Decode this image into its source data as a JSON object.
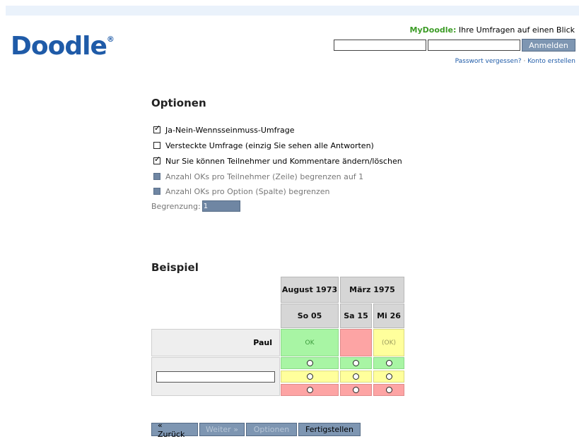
{
  "header": {
    "logo_text": "Doodle",
    "logo_mark": "®",
    "mydoodle_brand": "MyDoodle:",
    "mydoodle_tagline": "Ihre Umfragen auf einen Blick",
    "username_value": "",
    "password_value": "",
    "login_button": "Anmelden",
    "forgot_password": "Passwort vergessen?",
    "separator": "·",
    "create_account": "Konto erstellen"
  },
  "options": {
    "title": "Optionen",
    "items": [
      {
        "label": "Ja-Nein-Wennsseinmuss-Umfrage",
        "checked": true,
        "disabled": false
      },
      {
        "label": "Versteckte Umfrage (einzig Sie sehen alle Antworten)",
        "checked": false,
        "disabled": false
      },
      {
        "label": "Nur Sie können Teilnehmer und Kommentare ändern/löschen",
        "checked": true,
        "disabled": false
      },
      {
        "label": "Anzahl OKs pro Teilnehmer (Zeile) begrenzen auf 1",
        "checked": false,
        "disabled": true
      },
      {
        "label": "Anzahl OKs pro Option (Spalte) begrenzen",
        "checked": false,
        "disabled": true
      }
    ],
    "limit_label": "Begrenzung:",
    "limit_value": "1"
  },
  "example": {
    "title": "Beispiel",
    "months": [
      "August 1973",
      "März 1975"
    ],
    "days": [
      "So 05",
      "Sa 15",
      "Mi 26"
    ],
    "participant": {
      "name": "Paul",
      "answers": [
        "OK",
        "",
        "(OK)"
      ]
    },
    "colors": {
      "yes": "#a8f5a4",
      "no": "#fda4a4",
      "maybe": "#ffff9c"
    }
  },
  "nav": {
    "back": "« Zurück",
    "next": "Weiter »",
    "options": "Optionen",
    "finish": "Fertigstellen"
  }
}
